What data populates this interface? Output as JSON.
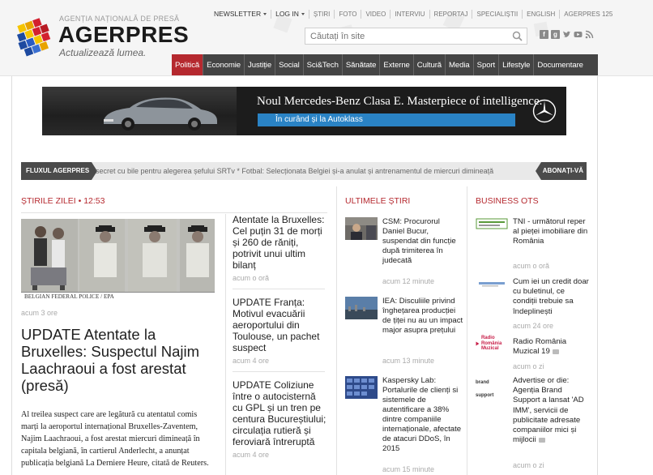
{
  "brand": {
    "agency": "AGENȚIA NAȚIONALĂ DE PRESĂ",
    "name": "AGERPRES",
    "slogan": "Actualizează lumea."
  },
  "top_nav": {
    "newsletter": "NEWSLETTER",
    "login": "LOG IN",
    "links": [
      "ȘTIRI",
      "FOTO",
      "VIDEO",
      "INTERVIU",
      "REPORTAJ",
      "SPECIALIȘTII",
      "ENGLISH",
      "AGERPRES 125"
    ]
  },
  "search": {
    "placeholder": "Căutați în site"
  },
  "main_nav": [
    "Politică",
    "Economie",
    "Justiție",
    "Social",
    "Sci&Tech",
    "Sănătate",
    "Externe",
    "Cultură",
    "Media",
    "Sport",
    "Lifestyle",
    "Documentare"
  ],
  "ad": {
    "headline": "Noul Mercedes-Benz Clasa E. Masterpiece of intelligence.",
    "cta": "În curând și la Autoklass"
  },
  "ticker": {
    "label": "FLUXUL AGERPRES",
    "text": "secret cu bile pentru alegerea șefului SRTv   *   Fotbal: Selecționata Belgiei și-a anulat și antrenamentul de miercuri dimineață",
    "subscribe": "ABONAȚI-VĂ"
  },
  "stiri_zilei": {
    "heading": "ȘTIRILE ZILEI",
    "time": "12:53",
    "lead": {
      "photo_caption": "BELGIAN FEDERAL POLICE / EPA",
      "time": "acum 3 ore",
      "title": "UPDATE Atentate la Bruxelles: Suspectul Najim Laachraoui a fost arestat (presă)",
      "body": "Al treilea suspect care are legătură cu atentatul comis marți la aeroportul internațional Bruxelles-Zaventem, Najim Laachraoui, a fost arestat miercuri dimineață în capitala belgiană, în cartierul Anderlecht, a anunțat publicația belgiană La Derniere Heure, citată de Reuters."
    },
    "stories": [
      {
        "title": "Atentate la Bruxelles: Cel puțin 31 de morți și 260 de răniți, potrivit unui ultim bilanț",
        "time": "acum o oră"
      },
      {
        "title": "UPDATE Franța: Motivul evacuării aeroportului din Toulouse, un pachet suspect",
        "time": "acum 4 ore"
      },
      {
        "title": "UPDATE Coliziune între o autocisternă cu GPL și un tren pe centura Bucureștiului; circulația rutieră și feroviară întreruptă",
        "time": "acum 4 ore"
      }
    ]
  },
  "ultimele_stiri": {
    "heading": "ULTIMELE ȘTIRI",
    "items": [
      {
        "title": "CSM: Procurorul Daniel Bucur, suspendat din funcție după trimiterea în judecată",
        "time": "acum 12 minute"
      },
      {
        "title": "IEA: Disculiile privind înghețarea producției de țiței nu au un impact major asupra prețului",
        "time": "acum 13 minute"
      },
      {
        "title": "Kaspersky Lab: Portalurile de clienți si sistemele de autentificare a 38% dintre companiile internaționale, afectate de atacuri DDoS, în 2015",
        "time": "acum 15 minute"
      }
    ]
  },
  "business_ots": {
    "heading": "BUSINESS OTS",
    "items": [
      {
        "title": "TNI - următorul reper al pieței imobiliare din România",
        "time": "acum o oră"
      },
      {
        "title": "Cum iei un credit doar cu buletinul, ce condiții trebuie sa îndeplinești",
        "time": "acum 24 ore"
      },
      {
        "title": "Radio România Muzical 19",
        "time": "acum o zi",
        "logo_text": "Radio România Muzical"
      },
      {
        "title": "Advertise or die: Agenția Brand Support a lansat 'AD IMM', servicii de publicitate adresate companiilor mici și mijlocii",
        "time": "acum o zi",
        "logo_text": "brand support"
      }
    ]
  },
  "colors": {
    "accent": "#b5292f",
    "nav_bg": "#444444",
    "ad_cta": "#2a83c5"
  }
}
